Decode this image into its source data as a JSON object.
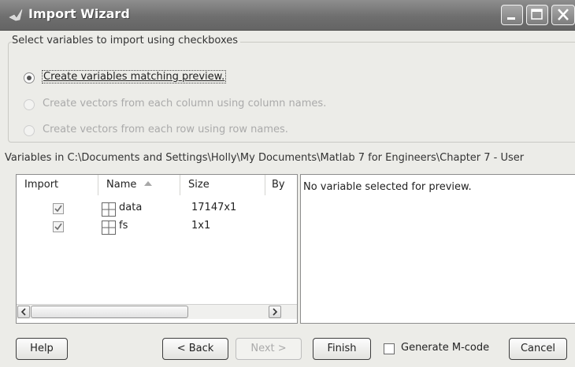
{
  "window": {
    "title": "Import Wizard",
    "title_icon": "matlab-icon",
    "controls": [
      "minimize-icon",
      "maximize-icon",
      "close-icon"
    ]
  },
  "select_group": {
    "legend": "Select variables to import using checkboxes",
    "options": [
      {
        "label": "Create variables matching preview.",
        "selected": true,
        "enabled": true
      },
      {
        "label": "Create vectors from each column using column names.",
        "selected": false,
        "enabled": false
      },
      {
        "label": "Create vectors from each row using row names.",
        "selected": false,
        "enabled": false
      }
    ]
  },
  "variables_path": "Variables in C:\\Documents and Settings\\Holly\\My Documents\\Matlab 7 for Engineers\\Chapter 7 - User",
  "table": {
    "columns": {
      "import": "Import",
      "name": "Name",
      "size": "Size",
      "bytes": "By"
    },
    "sort_indicator": "sort-ascending-icon",
    "rows": [
      {
        "import": true,
        "name": "data",
        "size": "17147x1",
        "icon": "grid-icon"
      },
      {
        "import": true,
        "name": "fs",
        "size": "1x1",
        "icon": "grid-icon"
      }
    ]
  },
  "preview": {
    "message": "No variable selected for preview."
  },
  "buttons": {
    "help": "Help",
    "back": "< Back",
    "next": "Next >",
    "finish": "Finish",
    "generate_mcode": "Generate M-code",
    "cancel": "Cancel"
  },
  "generate_mcode_checked": false,
  "colors": {
    "titlebar": "#707070",
    "dialog_bg": "#ecece8"
  }
}
